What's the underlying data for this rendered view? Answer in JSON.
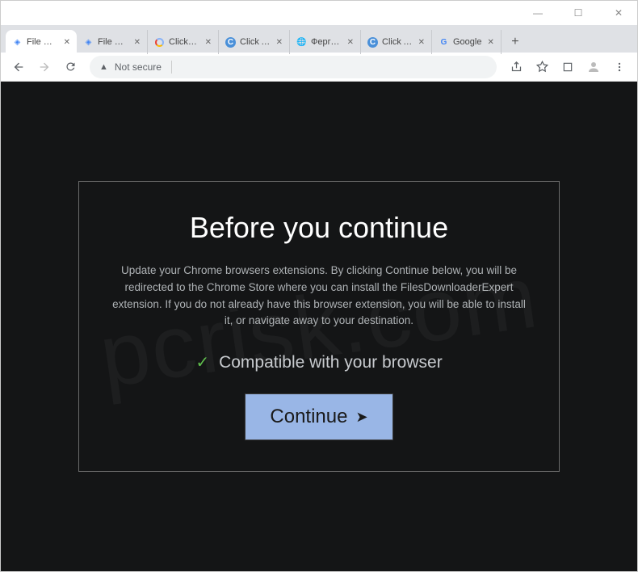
{
  "window": {
    "minimize": "—",
    "maximize": "☐",
    "close": "✕"
  },
  "tabs": [
    {
      "title": "File Downl...",
      "icon": "blue-cube",
      "active": true
    },
    {
      "title": "File Downl...",
      "icon": "blue-cube",
      "active": false
    },
    {
      "title": "Click &quo...",
      "icon": "ring",
      "active": false
    },
    {
      "title": "Click Allow",
      "icon": "c-blue",
      "active": false
    },
    {
      "title": "Фергана - ...",
      "icon": "globe",
      "active": false
    },
    {
      "title": "Click Allow",
      "icon": "c-blue",
      "active": false
    },
    {
      "title": "Google",
      "icon": "g",
      "active": false
    }
  ],
  "address": {
    "security_label": "Not secure"
  },
  "modal": {
    "heading": "Before you continue",
    "body": "Update your Chrome browsers extensions. By clicking Continue below, you will be redirected to the Chrome Store where you can install the FilesDownloaderExpert extension. If you do not already have this browser extension, you will be able to install it, or navigate away to your destination.",
    "compat_label": "Compatible with your browser",
    "continue_label": "Continue"
  },
  "watermark": "pcrisk.com"
}
